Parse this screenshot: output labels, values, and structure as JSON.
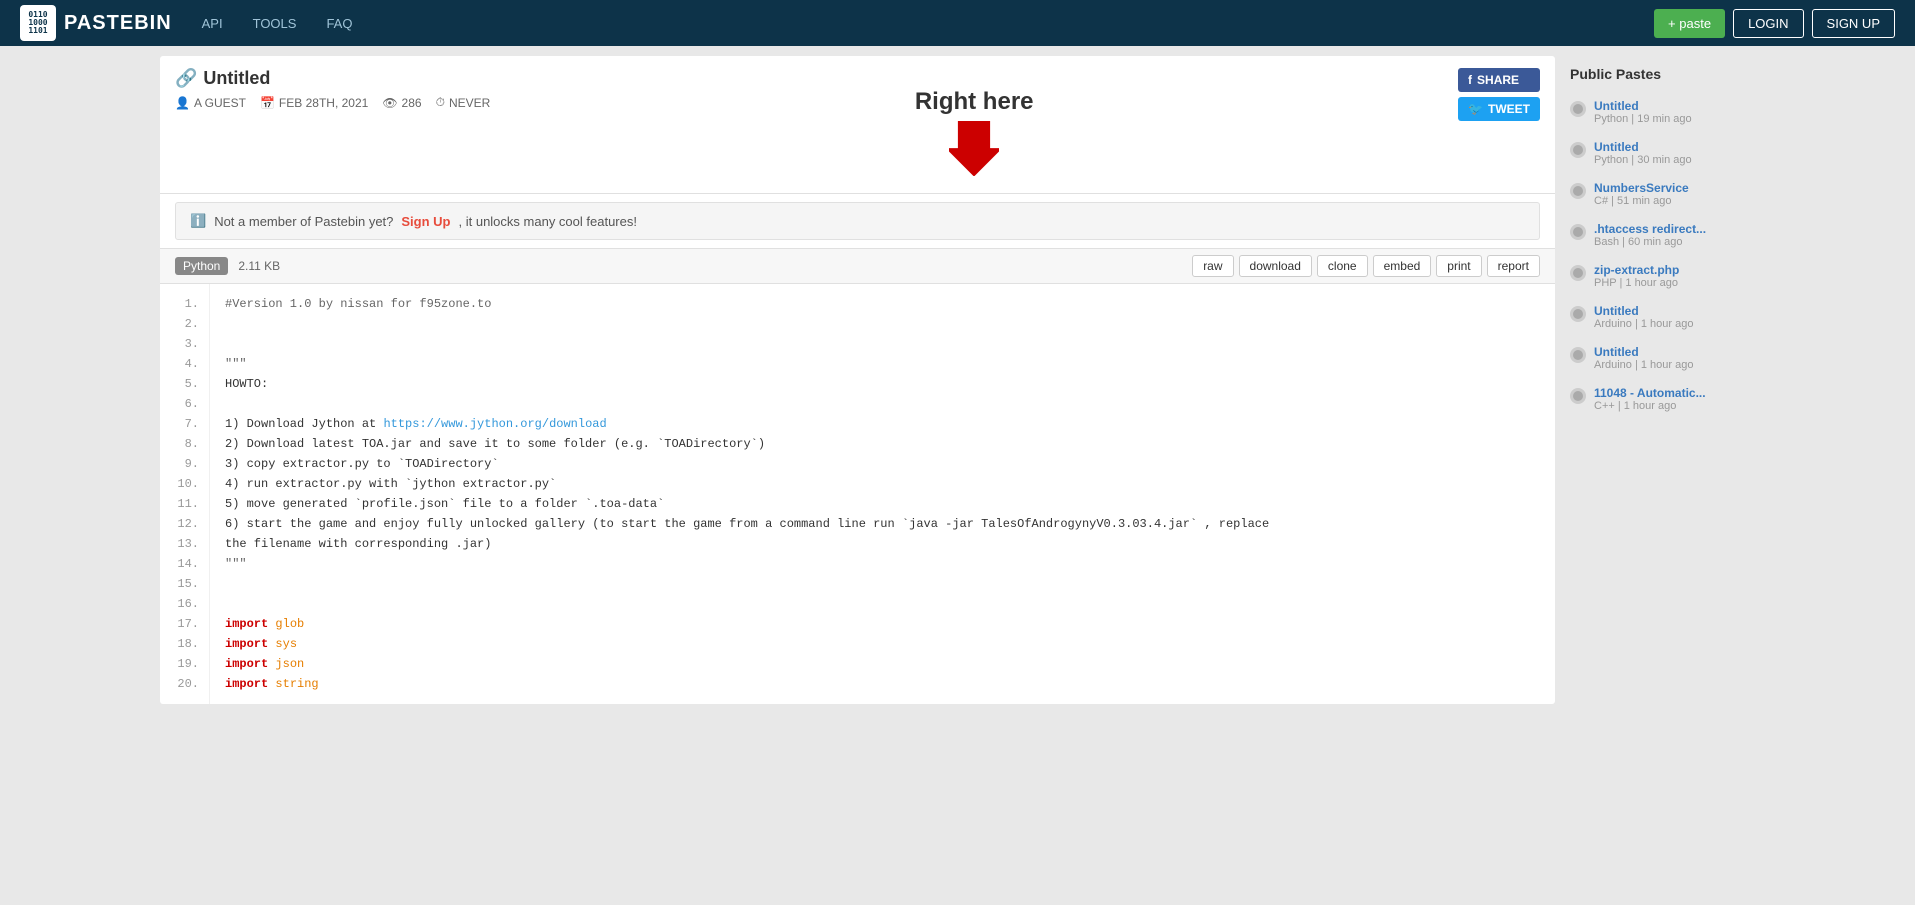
{
  "header": {
    "logo_text": "PASTEBIN",
    "nav": {
      "api": "API",
      "tools": "TOOLS",
      "faq": "FAQ"
    },
    "new_paste_btn": "+ paste",
    "login_btn": "LOGIN",
    "signup_btn": "SIGN UP"
  },
  "paste": {
    "title": "Untitled",
    "link_icon": "🔗",
    "author": "A GUEST",
    "date": "FEB 28TH, 2021",
    "views": "286",
    "expiry": "NEVER",
    "annotation_text": "Right here",
    "fb_share": "SHARE",
    "tw_tweet": "TWEET",
    "notice": "Not a member of Pastebin yet?",
    "notice_link": "Sign Up",
    "notice_suffix": ", it unlocks many cool features!",
    "lang": "Python",
    "file_size": "2.11 KB",
    "toolbar_btns": [
      "raw",
      "download",
      "clone",
      "embed",
      "print",
      "report"
    ],
    "code_lines": [
      "#Version 1.0 by nissan for f95zone.to",
      "",
      "",
      "\"\"\"",
      "HOWTO:",
      "",
      "1) Download Jython at https://www.jython.org/download",
      "2) Download latest TOA.jar and save it to some folder (e.g. `TOADirectory`)",
      "3) copy extractor.py to `TOADirectory`",
      "4) run extractor.py with `jython extractor.py`",
      "5) move generated `profile.json` file to a folder `.toa-data`",
      "6) start the game and enjoy fully unlocked gallery (to start the game from a command line run `java -jar TalesOfAndrogynyV0.3.03.4.jar` , replace",
      "the filename with corresponding .jar)",
      "\"\"\"",
      "",
      "",
      "import glob",
      "import sys",
      "import json",
      "import string"
    ]
  },
  "sidebar": {
    "header": "Public Pastes",
    "items": [
      {
        "title": "Untitled",
        "lang": "Python",
        "time": "19 min ago"
      },
      {
        "title": "Untitled",
        "lang": "Python",
        "time": "30 min ago"
      },
      {
        "title": "NumbersService",
        "lang": "C#",
        "time": "51 min ago"
      },
      {
        "title": ".htaccess redirect...",
        "lang": "Bash",
        "time": "60 min ago"
      },
      {
        "title": "zip-extract.php",
        "lang": "PHP",
        "time": "1 hour ago"
      },
      {
        "title": "Untitled",
        "lang": "Arduino",
        "time": "1 hour ago"
      },
      {
        "title": "Untitled",
        "lang": "Arduino",
        "time": "1 hour ago"
      },
      {
        "title": "11048 - Automatic...",
        "lang": "C++",
        "time": "1 hour ago"
      }
    ]
  }
}
